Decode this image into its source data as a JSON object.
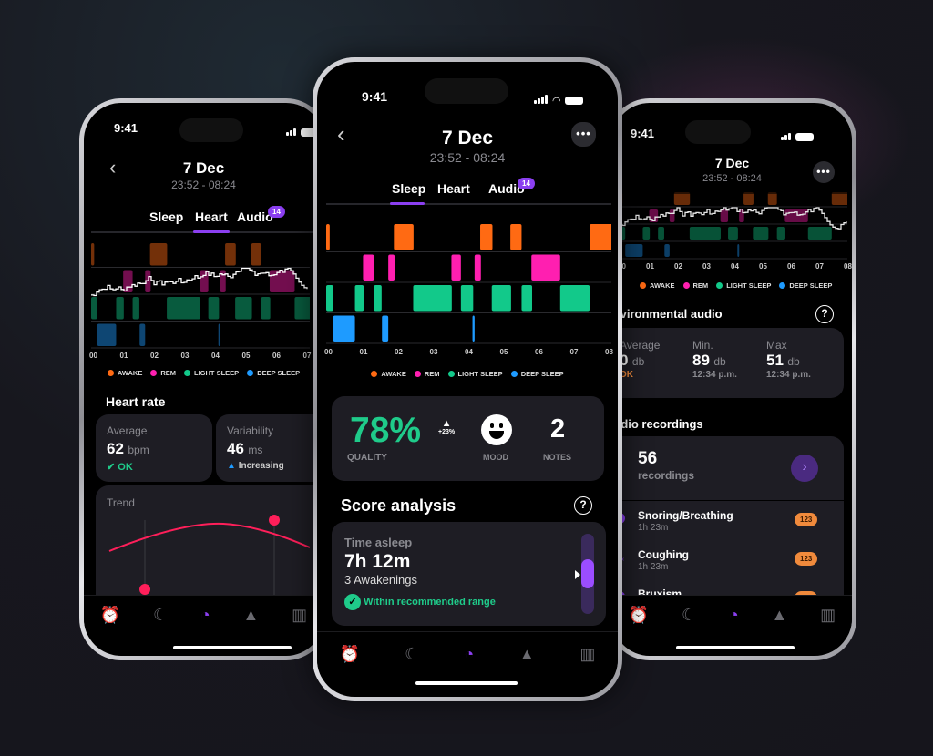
{
  "colors": {
    "awake": "#ff6a13",
    "rem": "#ff1fb0",
    "light": "#12c98a",
    "deep": "#1e9bff",
    "accent": "#8b3ff0",
    "heart": "#ff1f5a"
  },
  "common": {
    "time": "9:41",
    "date": "7 Dec",
    "range": "23:52 - 08:24",
    "tabs": [
      "Sleep",
      "Heart",
      "Audio"
    ],
    "audio_badge": "14",
    "axis": [
      "00",
      "01",
      "02",
      "03",
      "04",
      "05",
      "06",
      "07",
      "08"
    ],
    "legend": [
      "AWAKE",
      "REM",
      "LIGHT SLEEP",
      "DEEP SLEEP"
    ],
    "bottom_nav": [
      "alarm-icon",
      "sleep-moon-icon",
      "score-ring-icon",
      "sounds-icon",
      "stats-icon"
    ]
  },
  "hypnogram": [
    {
      "stage": "awake",
      "start": 0,
      "end": 0.1
    },
    {
      "stage": "light",
      "start": 0,
      "end": 0.2
    },
    {
      "stage": "deep",
      "start": 0.2,
      "end": 0.82
    },
    {
      "stage": "light",
      "start": 0.82,
      "end": 1.07
    },
    {
      "stage": "rem",
      "start": 1.05,
      "end": 1.36
    },
    {
      "stage": "light",
      "start": 1.36,
      "end": 1.58
    },
    {
      "stage": "deep",
      "start": 1.59,
      "end": 1.77
    },
    {
      "stage": "rem",
      "start": 1.77,
      "end": 1.95
    },
    {
      "stage": "awake",
      "start": 1.93,
      "end": 2.49
    },
    {
      "stage": "light",
      "start": 2.48,
      "end": 3.58
    },
    {
      "stage": "rem",
      "start": 3.57,
      "end": 3.84
    },
    {
      "stage": "light",
      "start": 3.84,
      "end": 4.19
    },
    {
      "stage": "deep",
      "start": 4.17,
      "end": 4.23
    },
    {
      "stage": "rem",
      "start": 4.23,
      "end": 4.41
    },
    {
      "stage": "awake",
      "start": 4.39,
      "end": 4.74
    },
    {
      "stage": "light",
      "start": 4.72,
      "end": 5.27
    },
    {
      "stage": "awake",
      "start": 5.25,
      "end": 5.57
    },
    {
      "stage": "light",
      "start": 5.57,
      "end": 5.87
    },
    {
      "stage": "rem",
      "start": 5.85,
      "end": 6.67
    },
    {
      "stage": "light",
      "start": 6.67,
      "end": 7.51
    },
    {
      "stage": "awake",
      "start": 7.51,
      "end": 8.19
    }
  ],
  "left": {
    "active_tab": "Heart",
    "section": "Heart rate",
    "average": {
      "label": "Average",
      "value": "62",
      "unit": "bpm",
      "status": "OK"
    },
    "variability": {
      "label": "Variability",
      "value": "46",
      "unit": "ms",
      "status": "Increasing"
    },
    "trend": {
      "label": "Trend"
    }
  },
  "center": {
    "active_tab": "Sleep",
    "quality": {
      "value": "78%",
      "label": "QUALITY",
      "change": "+23%"
    },
    "mood": {
      "label": "MOOD",
      "icon": "smiley-icon"
    },
    "notes": {
      "value": "2",
      "label": "NOTES"
    },
    "score_title": "Score analysis",
    "time_asleep": {
      "label": "Time asleep",
      "value": "7h 12m",
      "awakenings": "3 Awakenings",
      "status": "Within recommended range",
      "level": 0.5
    }
  },
  "right": {
    "active_tab": "Audio",
    "env_title": "Environmental audio",
    "env": [
      {
        "label": "Average",
        "value": "0",
        "unit": "db",
        "note": "OK"
      },
      {
        "label": "Min.",
        "value": "89",
        "unit": "db",
        "note": "12:34 p.m."
      },
      {
        "label": "Max",
        "value": "51",
        "unit": "db",
        "note": "12:34 p.m."
      }
    ],
    "rec_title": "Audio recordings",
    "recordings": {
      "count": "56",
      "label": "recordings"
    },
    "items": [
      {
        "name": "Snoring/Breathing",
        "duration": "1h 23m",
        "count": "123"
      },
      {
        "name": "Coughing",
        "duration": "1h 23m",
        "count": "123"
      },
      {
        "name": "Bruxism",
        "duration": "",
        "count": "123"
      }
    ]
  }
}
